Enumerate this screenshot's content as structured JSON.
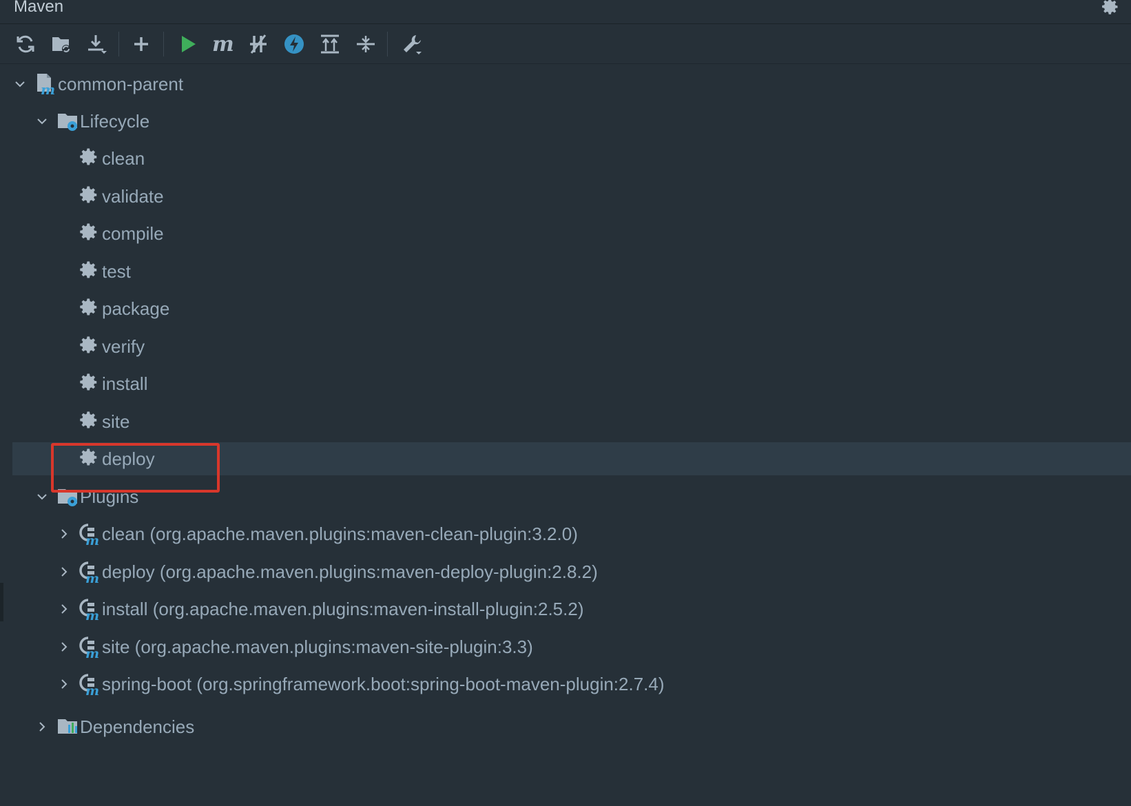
{
  "window": {
    "title": "Maven"
  },
  "toolbar": {
    "buttons": [
      {
        "name": "reload-all-icon"
      },
      {
        "name": "generate-sources-icon"
      },
      {
        "name": "download-sources-icon"
      },
      {
        "name": "add-project-icon"
      },
      {
        "name": "run-icon",
        "color": "#3fae5b"
      },
      {
        "name": "execute-goal-icon"
      },
      {
        "name": "skip-tests-icon"
      },
      {
        "name": "offline-mode-icon",
        "color": "#3592c4"
      },
      {
        "name": "expand-all-icon"
      },
      {
        "name": "collapse-all-icon"
      },
      {
        "name": "build-tools-settings-icon"
      }
    ]
  },
  "tree": {
    "root": {
      "label": "common-parent"
    },
    "lifecycle": {
      "label": "Lifecycle",
      "goals": [
        "clean",
        "validate",
        "compile",
        "test",
        "package",
        "verify",
        "install",
        "site",
        "deploy"
      ],
      "selected": "deploy"
    },
    "plugins": {
      "label": "Plugins",
      "items": [
        "clean (org.apache.maven.plugins:maven-clean-plugin:3.2.0)",
        "deploy (org.apache.maven.plugins:maven-deploy-plugin:2.8.2)",
        "install (org.apache.maven.plugins:maven-install-plugin:2.5.2)",
        "site (org.apache.maven.plugins:maven-site-plugin:3.3)",
        "spring-boot (org.springframework.boot:spring-boot-maven-plugin:2.7.4)"
      ]
    },
    "dependencies": {
      "label": "Dependencies"
    }
  },
  "colors": {
    "background": "#263038",
    "selection": "#2f3d48",
    "text": "#97a9b8",
    "highlight_border": "#d8372b",
    "maven_accent": "#3aa0d8"
  }
}
